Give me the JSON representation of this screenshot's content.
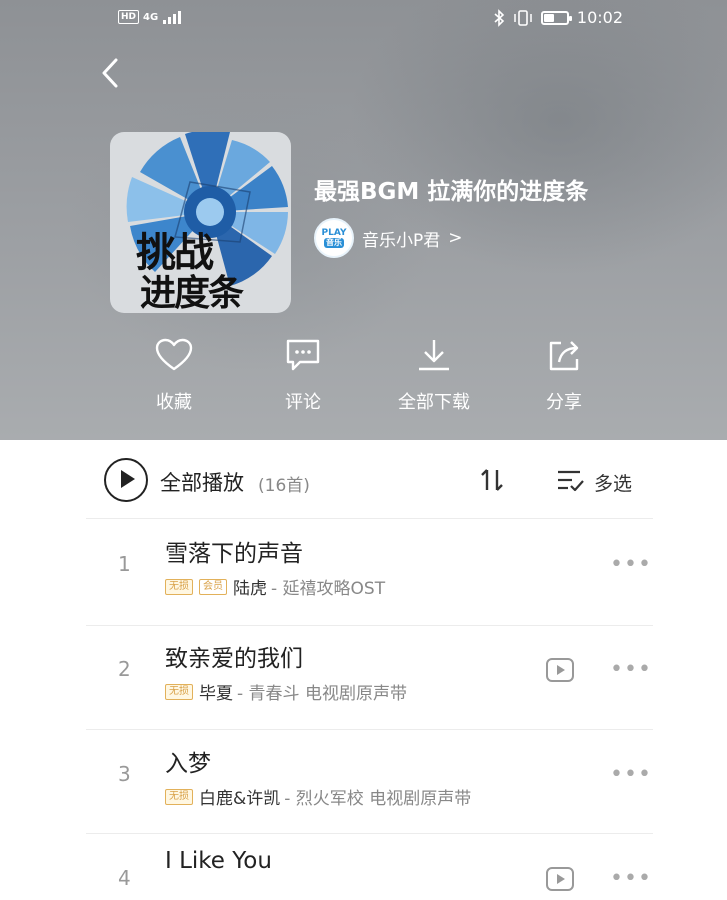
{
  "status_bar": {
    "network": "4G",
    "time": "10:02",
    "battery_level": 0.45
  },
  "playlist": {
    "title": "最强BGM 拉满你的进度条",
    "cover_text_line1": "挑战",
    "cover_text_line2": "进度条",
    "creator": {
      "avatar_text_top": "PLAY",
      "avatar_text_bottom": "音乐",
      "name": "音乐小P君",
      "chevron": ">"
    }
  },
  "actions": [
    {
      "label": "收藏",
      "icon": "heart-icon"
    },
    {
      "label": "评论",
      "icon": "comment-icon"
    },
    {
      "label": "全部下载",
      "icon": "download-icon"
    },
    {
      "label": "分享",
      "icon": "share-icon"
    }
  ],
  "list_header": {
    "play_all_label": "全部播放",
    "count_text": "(16首)",
    "multi_select_label": "多选"
  },
  "songs": [
    {
      "index": "1",
      "title": "雪落下的声音",
      "badges": [
        "无损",
        "会员"
      ],
      "artist": "陆虎",
      "album": " - 延禧攻略OST",
      "has_mv": false
    },
    {
      "index": "2",
      "title": "致亲爱的我们",
      "badges": [
        "无损"
      ],
      "artist": "毕夏",
      "album": " - 青春斗 电视剧原声带",
      "has_mv": true
    },
    {
      "index": "3",
      "title": "入梦",
      "badges": [
        "无损"
      ],
      "artist": "白鹿&许凯",
      "album": " - 烈火军校 电视剧原声带",
      "has_mv": false
    },
    {
      "index": "4",
      "title": "I Like You",
      "badges": [],
      "artist": "",
      "album": "",
      "has_mv": true
    }
  ],
  "colors": {
    "header_bg": "#9a9da1",
    "badge": "#d9a24a",
    "text_primary": "#222222",
    "text_secondary": "#888888"
  }
}
